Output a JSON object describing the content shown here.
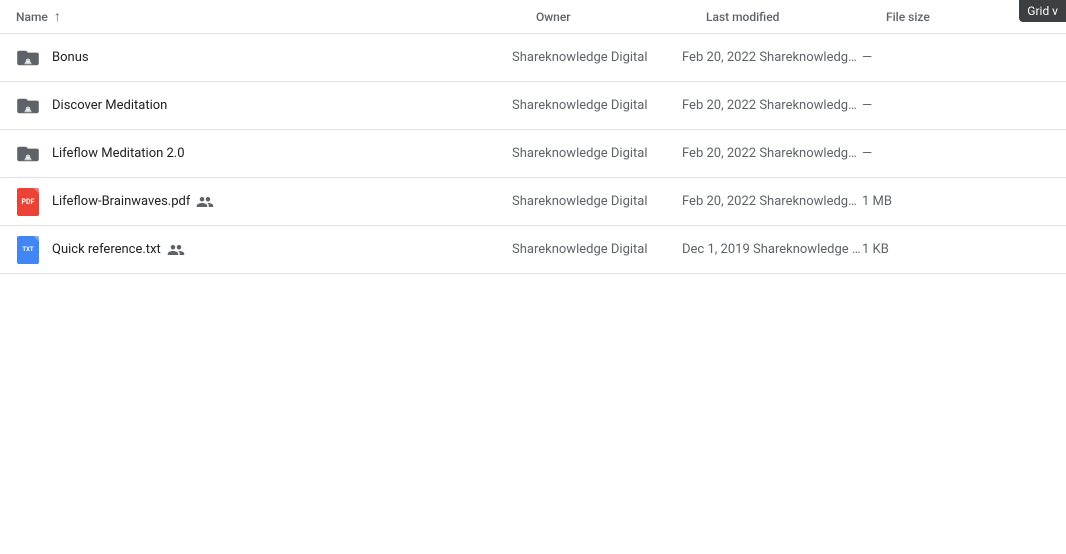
{
  "gridViewButton": {
    "label": "Grid v"
  },
  "header": {
    "columns": {
      "name": "Name",
      "sortArrow": "↑",
      "owner": "Owner",
      "lastModified": "Last modified",
      "fileSize": "File size"
    }
  },
  "files": [
    {
      "id": "bonus",
      "name": "Bonus",
      "type": "shared-folder",
      "owner": "Shareknowledge Digital",
      "modifiedDate": "Feb 20, 2022",
      "modifiedBy": "Shareknowledge ...",
      "size": "—",
      "shared": false
    },
    {
      "id": "discover-meditation",
      "name": "Discover Meditation",
      "type": "shared-folder",
      "owner": "Shareknowledge Digital",
      "modifiedDate": "Feb 20, 2022",
      "modifiedBy": "Shareknowledge ...",
      "size": "—",
      "shared": false
    },
    {
      "id": "lifeflow-meditation",
      "name": "Lifeflow Meditation 2.0",
      "type": "shared-folder",
      "owner": "Shareknowledge Digital",
      "modifiedDate": "Feb 20, 2022",
      "modifiedBy": "Shareknowledge ...",
      "size": "—",
      "shared": false
    },
    {
      "id": "lifeflow-brainwaves",
      "name": "Lifeflow-Brainwaves.pdf",
      "type": "pdf",
      "owner": "Shareknowledge Digital",
      "modifiedDate": "Feb 20, 2022",
      "modifiedBy": "Shareknowledge ...",
      "size": "1 MB",
      "shared": true
    },
    {
      "id": "quick-reference",
      "name": "Quick reference.txt",
      "type": "txt",
      "owner": "Shareknowledge Digital",
      "modifiedDate": "Dec 1, 2019",
      "modifiedBy": "Shareknowledge ...",
      "size": "1 KB",
      "shared": true
    }
  ]
}
